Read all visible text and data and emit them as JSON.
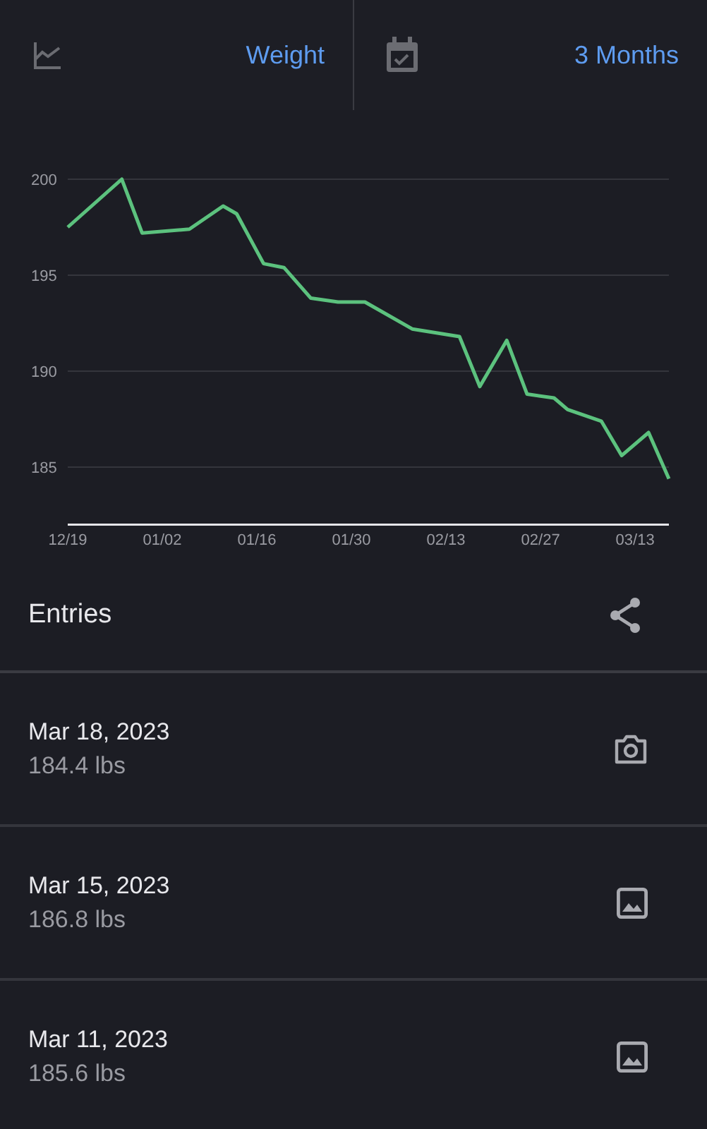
{
  "toolbar": {
    "metric": "Weight",
    "range": "3 Months"
  },
  "chart_data": {
    "type": "line",
    "x": [
      "2022-12-19",
      "2022-12-27",
      "2022-12-30",
      "2023-01-06",
      "2023-01-11",
      "2023-01-13",
      "2023-01-17",
      "2023-01-20",
      "2023-01-24",
      "2023-01-28",
      "2023-02-01",
      "2023-02-08",
      "2023-02-15",
      "2023-02-18",
      "2023-02-22",
      "2023-02-25",
      "2023-03-01",
      "2023-03-03",
      "2023-03-08",
      "2023-03-11",
      "2023-03-15",
      "2023-03-18"
    ],
    "series": [
      {
        "color": "#5cc27e",
        "values": [
          197.5,
          200,
          197.2,
          197.4,
          198.6,
          198.2,
          195.6,
          195.4,
          193.8,
          193.6,
          193.6,
          192.2,
          191.8,
          189.2,
          191.6,
          188.8,
          188.6,
          188.0,
          187.4,
          185.6,
          186.8,
          184.4
        ]
      }
    ],
    "xlim": [
      "2022-12-19",
      "2023-03-18"
    ],
    "ylim": [
      182,
      200
    ],
    "grid": true,
    "xticks": [
      {
        "value": "2022-12-19",
        "label": "12/19"
      },
      {
        "value": "2023-01-02",
        "label": "01/02"
      },
      {
        "value": "2023-01-16",
        "label": "01/16"
      },
      {
        "value": "2023-01-30",
        "label": "01/30"
      },
      {
        "value": "2023-02-13",
        "label": "02/13"
      },
      {
        "value": "2023-02-27",
        "label": "02/27"
      },
      {
        "value": "2023-03-13",
        "label": "03/13"
      }
    ],
    "yticks": [
      185,
      190,
      195,
      200
    ]
  },
  "entries_title": "Entries",
  "entries": [
    {
      "date": "Mar 18, 2023",
      "weight": "184.4 lbs",
      "kind": "camera"
    },
    {
      "date": "Mar 15, 2023",
      "weight": "186.8 lbs",
      "kind": "image"
    },
    {
      "date": "Mar 11, 2023",
      "weight": "185.6 lbs",
      "kind": "image"
    }
  ]
}
